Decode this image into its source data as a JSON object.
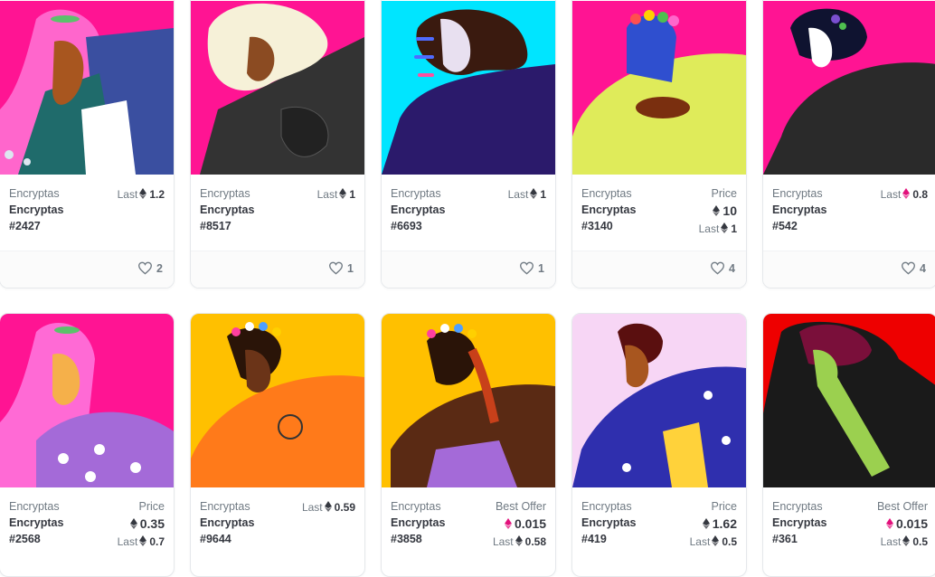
{
  "colors": {
    "eth_dark": "#353840",
    "eth_pink": "#e2107b",
    "muted_text": "#707a83",
    "border": "#e5e8eb"
  },
  "icons": {
    "currency": "ethereum-icon",
    "like": "heart-icon"
  },
  "cards": [
    {
      "collection": "Encryptas",
      "name": "Encryptas",
      "number": "#2427",
      "label": "",
      "price": "",
      "last_label": "Last",
      "last": "1.2",
      "likes": "2",
      "bg": "#ff1493"
    },
    {
      "collection": "Encryptas",
      "name": "Encryptas",
      "number": "#8517",
      "label": "",
      "price": "",
      "last_label": "Last",
      "last": "1",
      "likes": "1",
      "bg": "#ff1493"
    },
    {
      "collection": "Encryptas",
      "name": "Encryptas",
      "number": "#6693",
      "label": "",
      "price": "",
      "last_label": "Last",
      "last": "1",
      "likes": "1",
      "bg": "#00e5ff"
    },
    {
      "collection": "Encryptas",
      "name": "Encryptas",
      "number": "#3140",
      "label": "Price",
      "price": "10",
      "last_label": "Last",
      "last": "1",
      "likes": "4",
      "bg": "#ff1493"
    },
    {
      "collection": "Encryptas",
      "name": "Encryptas",
      "number": "#542",
      "label": "",
      "price": "",
      "last_label": "Last",
      "last": "0.8",
      "likes": "4",
      "bg": "#ff1493"
    },
    {
      "collection": "Encryptas",
      "name": "Encryptas",
      "number": "#2568",
      "label": "Price",
      "price": "0.35",
      "last_label": "Last",
      "last": "0.7",
      "likes": "",
      "bg": "#ff1493"
    },
    {
      "collection": "Encryptas",
      "name": "Encryptas",
      "number": "#9644",
      "label": "",
      "price": "",
      "last_label": "Last",
      "last": "0.59",
      "likes": "",
      "bg": "#ffc000"
    },
    {
      "collection": "Encryptas",
      "name": "Encryptas",
      "number": "#3858",
      "label": "Best Offer",
      "price": "0.015",
      "last_label": "Last",
      "last": "0.58",
      "likes": "",
      "bg": "#ffc000"
    },
    {
      "collection": "Encryptas",
      "name": "Encryptas",
      "number": "#419",
      "label": "Price",
      "price": "1.62",
      "last_label": "Last",
      "last": "0.5",
      "likes": "",
      "bg": "#f7d6f5"
    },
    {
      "collection": "Encryptas",
      "name": "Encryptas",
      "number": "#361",
      "label": "Best Offer",
      "price": "0.015",
      "last_label": "Last",
      "last": "0.5",
      "likes": "",
      "bg": "#ee0000"
    }
  ]
}
